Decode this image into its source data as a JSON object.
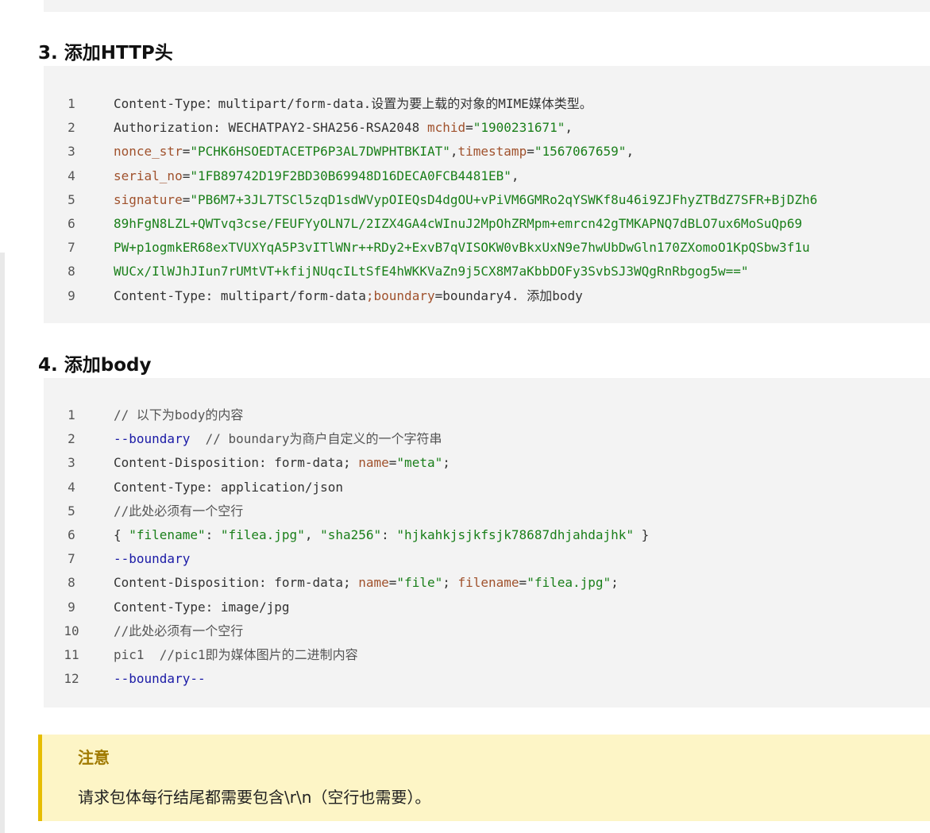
{
  "sections": [
    {
      "heading": "3. 添加HTTP头",
      "lines": [
        {
          "n": "1",
          "tokens": [
            {
              "t": "Content-Type：multipart/form-data.设置为要上载的对象的MIME媒体类型。",
              "c": "plain"
            }
          ]
        },
        {
          "n": "2",
          "tokens": [
            {
              "t": "Authorization: WECHATPAY2-SHA256-RSA2048 ",
              "c": "plain"
            },
            {
              "t": "mchid",
              "c": "attr"
            },
            {
              "t": "=",
              "c": "plain"
            },
            {
              "t": "\"1900231671\"",
              "c": "str"
            },
            {
              "t": ",",
              "c": "plain"
            }
          ]
        },
        {
          "n": "3",
          "tokens": [
            {
              "t": "nonce_str",
              "c": "attr"
            },
            {
              "t": "=",
              "c": "plain"
            },
            {
              "t": "\"PCHK6HSOEDTACETP6P3AL7DWPHTBKIAT\"",
              "c": "str"
            },
            {
              "t": ",",
              "c": "plain"
            },
            {
              "t": "timestamp",
              "c": "attr"
            },
            {
              "t": "=",
              "c": "plain"
            },
            {
              "t": "\"1567067659\"",
              "c": "str"
            },
            {
              "t": ",",
              "c": "plain"
            }
          ]
        },
        {
          "n": "4",
          "tokens": [
            {
              "t": "serial_no",
              "c": "attr"
            },
            {
              "t": "=",
              "c": "plain"
            },
            {
              "t": "\"1FB89742D19F2BD30B69948D16DECA0FCB4481EB\"",
              "c": "str"
            },
            {
              "t": ",",
              "c": "plain"
            }
          ]
        },
        {
          "n": "5",
          "tokens": [
            {
              "t": "signature",
              "c": "attr"
            },
            {
              "t": "=",
              "c": "plain"
            },
            {
              "t": "\"PB6M7+3JL7TSCl5zqD1sdWVypOIEQsD4dgOU+vPiVM6GMRo2qYSWKf8u46i9ZJFhyZTBdZ7SFR+BjDZh6",
              "c": "str"
            }
          ]
        },
        {
          "n": "6",
          "tokens": [
            {
              "t": "89hFgN8LZL+QWTvq3cse/FEUFYyOLN7L/2IZX4GA4cWInuJ2MpOhZRMpm+emrcn42gTMKAPNQ7dBLO7ux6MoSuQp69",
              "c": "str"
            }
          ]
        },
        {
          "n": "7",
          "tokens": [
            {
              "t": "PW+p1ogmkER68exTVUXYqA5P3vITlWNr++RDy2+ExvB7qVISOKW0vBkxUxN9e7hwUbDwGln170ZXomoO1KpQSbw3f1u",
              "c": "str"
            }
          ]
        },
        {
          "n": "8",
          "tokens": [
            {
              "t": "WUCx/IlWJhJIun7rUMtVT+kfijNUqcILtSfE4hWKKVaZn9j5CX8M7aKbbDOFy3SvbSJ3WQgRnRbgog5w==\"",
              "c": "str"
            }
          ]
        },
        {
          "n": "9",
          "tokens": [
            {
              "t": "Content-Type: multipart/form-data",
              "c": "plain"
            },
            {
              "t": ";boundary",
              "c": "attr"
            },
            {
              "t": "=boundary4. 添加body",
              "c": "plain"
            }
          ]
        }
      ]
    },
    {
      "heading": "4. 添加body",
      "lines": [
        {
          "n": "1",
          "tokens": [
            {
              "t": "// 以下为body的内容",
              "c": "com"
            }
          ]
        },
        {
          "n": "2",
          "tokens": [
            {
              "t": "--boundary",
              "c": "kw"
            },
            {
              "t": "  // boundary为商户自定义的一个字符串",
              "c": "com"
            }
          ]
        },
        {
          "n": "3",
          "tokens": [
            {
              "t": "Content-Disposition: form-data; ",
              "c": "plain"
            },
            {
              "t": "name",
              "c": "attr"
            },
            {
              "t": "=",
              "c": "plain"
            },
            {
              "t": "\"meta\"",
              "c": "str"
            },
            {
              "t": ";",
              "c": "plain"
            }
          ]
        },
        {
          "n": "4",
          "tokens": [
            {
              "t": "Content-Type: application/json",
              "c": "plain"
            }
          ]
        },
        {
          "n": "5",
          "tokens": [
            {
              "t": "//此处必须有一个空行",
              "c": "com"
            }
          ]
        },
        {
          "n": "6",
          "tokens": [
            {
              "t": "{ ",
              "c": "plain"
            },
            {
              "t": "\"filename\"",
              "c": "str"
            },
            {
              "t": ": ",
              "c": "plain"
            },
            {
              "t": "\"filea.jpg\"",
              "c": "str"
            },
            {
              "t": ", ",
              "c": "plain"
            },
            {
              "t": "\"sha256\"",
              "c": "str"
            },
            {
              "t": ": ",
              "c": "plain"
            },
            {
              "t": "\"hjkahkjsjkfsjk78687dhjahdajhk\"",
              "c": "str"
            },
            {
              "t": " }",
              "c": "plain"
            }
          ]
        },
        {
          "n": "7",
          "tokens": [
            {
              "t": "--boundary",
              "c": "kw"
            }
          ]
        },
        {
          "n": "8",
          "tokens": [
            {
              "t": "Content-Disposition: form-data; ",
              "c": "plain"
            },
            {
              "t": "name",
              "c": "attr"
            },
            {
              "t": "=",
              "c": "plain"
            },
            {
              "t": "\"file\"",
              "c": "str"
            },
            {
              "t": "; ",
              "c": "plain"
            },
            {
              "t": "filename",
              "c": "attr"
            },
            {
              "t": "=",
              "c": "plain"
            },
            {
              "t": "\"filea.jpg\"",
              "c": "str"
            },
            {
              "t": ";",
              "c": "plain"
            }
          ]
        },
        {
          "n": "9",
          "tokens": [
            {
              "t": "Content-Type: image/jpg",
              "c": "plain"
            }
          ]
        },
        {
          "n": "10",
          "tokens": [
            {
              "t": "//此处必须有一个空行",
              "c": "com"
            }
          ]
        },
        {
          "n": "11",
          "tokens": [
            {
              "t": "pic1  //pic1即为媒体图片的二进制内容",
              "c": "com"
            }
          ]
        },
        {
          "n": "12",
          "tokens": [
            {
              "t": "--boundary--",
              "c": "kw"
            }
          ]
        }
      ]
    }
  ],
  "note": {
    "title": "注意",
    "body": "请求包体每行结尾都需要包含\\r\\n（空行也需要）。"
  },
  "colors": {
    "code_background": "#f3f3f3",
    "attribute": "#a0522d",
    "string": "#1a7f1a",
    "keyword": "#1a1aa6",
    "note_background": "#fdf5c6",
    "note_border": "#e6bd00",
    "note_title": "#a07a00"
  }
}
